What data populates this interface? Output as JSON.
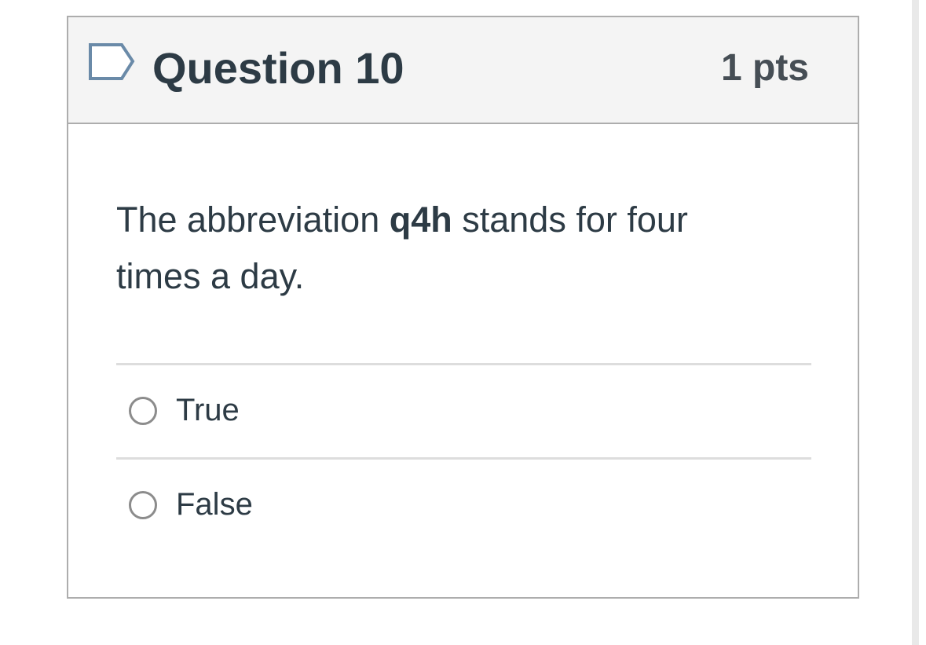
{
  "question": {
    "title": "Question 10",
    "points": "1 pts",
    "flag_icon": "flag-outline-icon",
    "text_before": "The abbreviation ",
    "text_bold": "q4h",
    "text_after": " stands for four times a day."
  },
  "answers": [
    {
      "label": "True",
      "selected": false
    },
    {
      "label": "False",
      "selected": false
    }
  ],
  "colors": {
    "header_bg": "#f4f4f4",
    "border": "#adadad",
    "text": "#2d3b45",
    "flag": "#6a8aa8"
  }
}
